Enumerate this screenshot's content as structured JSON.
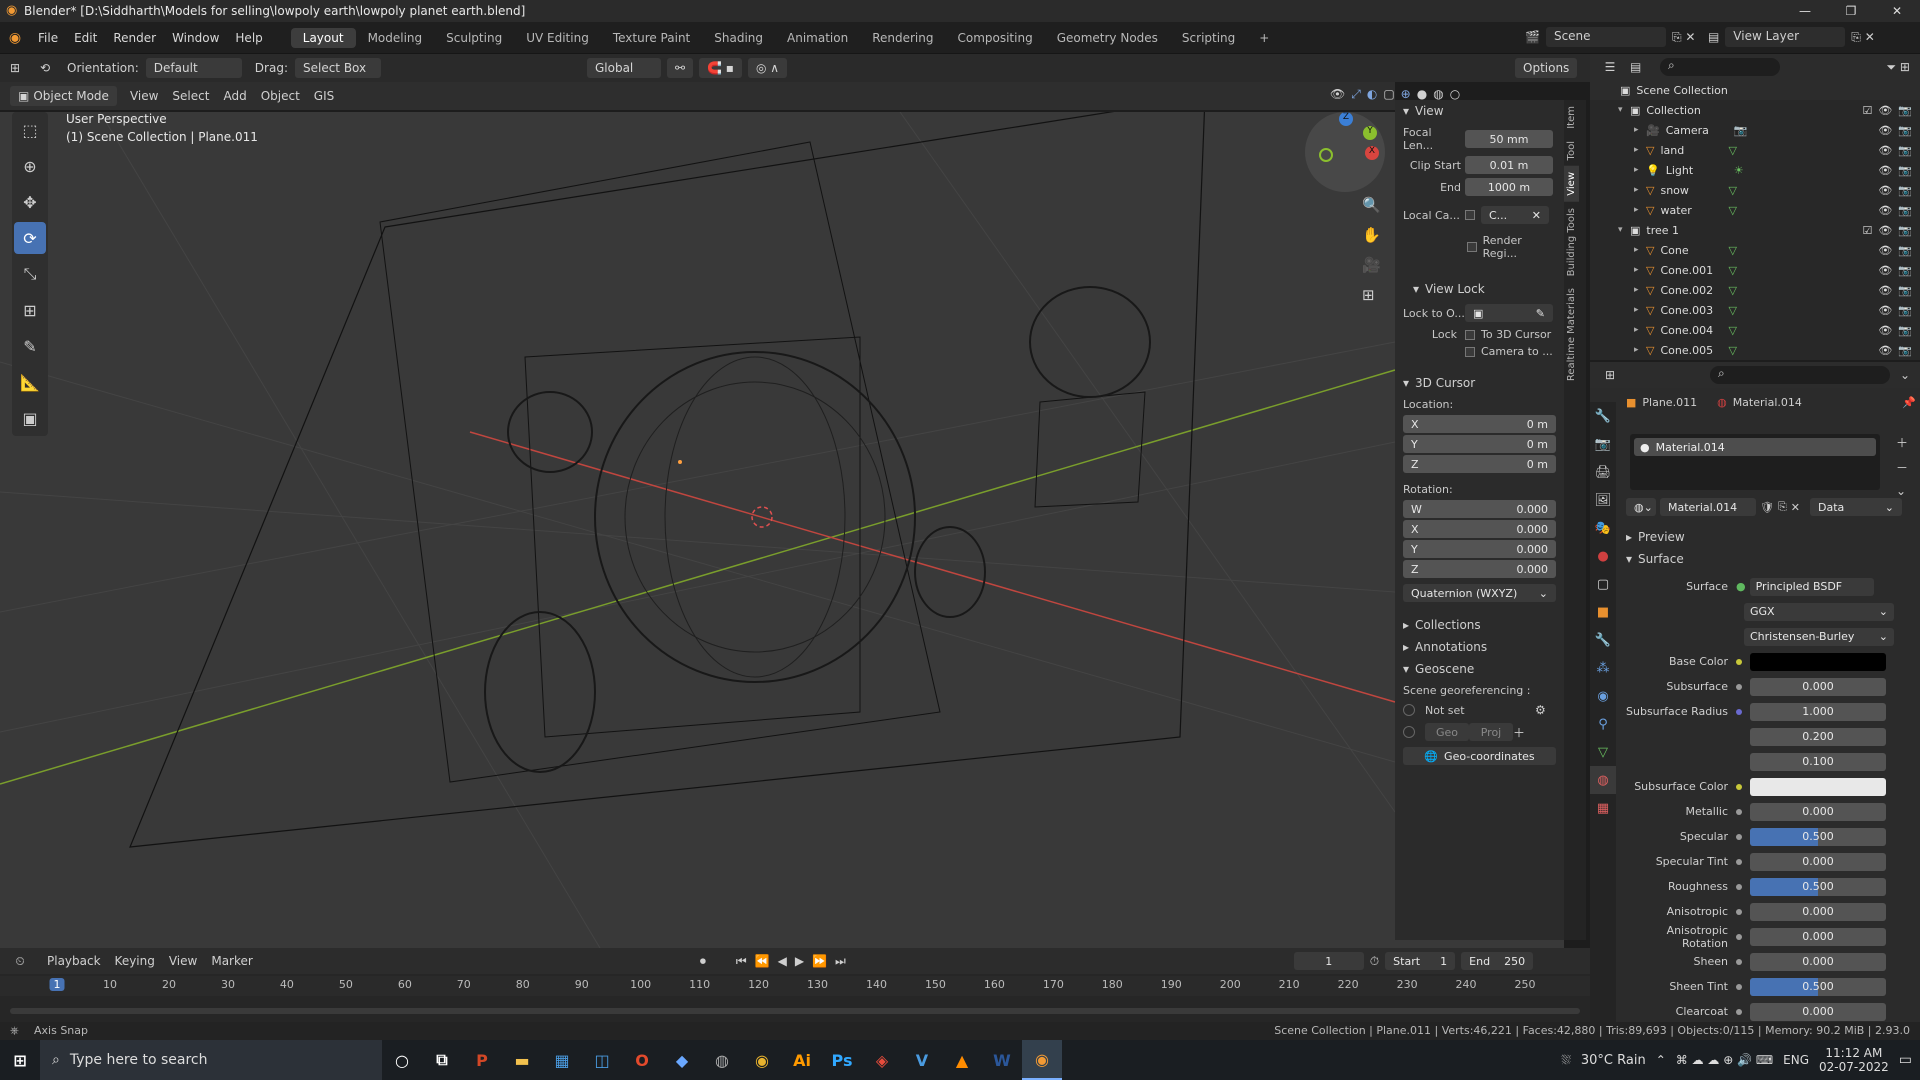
{
  "window": {
    "title": "Blender* [D:\\Siddharth\\Models for selling\\lowpoly earth\\lowpoly planet earth.blend]"
  },
  "menu": [
    "File",
    "Edit",
    "Render",
    "Window",
    "Help"
  ],
  "workspaces": [
    "Layout",
    "Modeling",
    "Sculpting",
    "UV Editing",
    "Texture Paint",
    "Shading",
    "Animation",
    "Rendering",
    "Compositing",
    "Geometry Nodes",
    "Scripting",
    "+"
  ],
  "scene": {
    "label": "Scene",
    "view_layer": "View Layer"
  },
  "toolheader": {
    "orientation_label": "Orientation:",
    "orientation_value": "Default",
    "drag_label": "Drag:",
    "drag_value": "Select Box",
    "transform": "Global",
    "options": "Options"
  },
  "viewport_header": {
    "mode": "Object Mode",
    "items": [
      "View",
      "Select",
      "Add",
      "Object",
      "GIS"
    ]
  },
  "viewport": {
    "perspective": "User Perspective",
    "context": "(1) Scene Collection | Plane.011"
  },
  "npanel": {
    "view_title": "View",
    "focal_label": "Focal Len...",
    "focal": "50 mm",
    "clip_start_label": "Clip Start",
    "clip_start": "0.01 m",
    "end_label": "End",
    "end": "1000 m",
    "local_cam_label": "Local Ca...",
    "local_cam_value": "C...",
    "render_region": "Render Regi...",
    "view_lock_title": "View Lock",
    "lock_to_label": "Lock to O...",
    "lock_label": "Lock",
    "to_cursor": "To 3D Cursor",
    "camera_to": "Camera to ...",
    "cursor_title": "3D Cursor",
    "location_label": "Location:",
    "loc_x": "0 m",
    "loc_y": "0 m",
    "loc_z": "0 m",
    "rotation_label": "Rotation:",
    "rot_w": "0.000",
    "rot_x": "0.000",
    "rot_y": "0.000",
    "rot_z": "0.000",
    "rot_mode": "Quaternion (WXYZ)",
    "collections": "Collections",
    "annotations": "Annotations",
    "geoscene": "Geoscene",
    "georef": "Scene georeferencing :",
    "not_set": "Not set",
    "geo_btn": "Geo",
    "proj_btn": "Proj",
    "geocoords": "Geo-coordinates"
  },
  "vtabs": [
    "Item",
    "Tool",
    "View",
    "Building Tools",
    "Realtime Materials"
  ],
  "outliner": {
    "root": "Scene Collection",
    "items": [
      {
        "name": "Collection",
        "level": 1,
        "kind": "collection"
      },
      {
        "name": "Camera",
        "level": 2,
        "kind": "camera"
      },
      {
        "name": "land",
        "level": 2,
        "kind": "mesh"
      },
      {
        "name": "Light",
        "level": 2,
        "kind": "light"
      },
      {
        "name": "snow",
        "level": 2,
        "kind": "mesh"
      },
      {
        "name": "water",
        "level": 2,
        "kind": "mesh"
      },
      {
        "name": "tree 1",
        "level": 1,
        "kind": "collection"
      },
      {
        "name": "Cone",
        "level": 2,
        "kind": "mesh"
      },
      {
        "name": "Cone.001",
        "level": 2,
        "kind": "mesh"
      },
      {
        "name": "Cone.002",
        "level": 2,
        "kind": "mesh"
      },
      {
        "name": "Cone.003",
        "level": 2,
        "kind": "mesh"
      },
      {
        "name": "Cone.004",
        "level": 2,
        "kind": "mesh"
      },
      {
        "name": "Cone.005",
        "level": 2,
        "kind": "mesh"
      }
    ]
  },
  "properties": {
    "object": "Plane.011",
    "material": "Material.014",
    "slot": "Material.014",
    "link": "Data",
    "preview": "Preview",
    "surface_section": "Surface",
    "surface_label": "Surface",
    "surface_value": "Principled BSDF",
    "distribution": "GGX",
    "subsurface_method": "Christensen-Burley",
    "rows": [
      {
        "label": "Base Color",
        "value": "",
        "swatch": "#000000"
      },
      {
        "label": "Subsurface",
        "value": "0.000"
      },
      {
        "label": "Subsurface Radius",
        "value": "1.000"
      },
      {
        "label": "",
        "value": "0.200"
      },
      {
        "label": "",
        "value": "0.100"
      },
      {
        "label": "Subsurface Color",
        "value": "",
        "swatch": "#e8e8e8"
      },
      {
        "label": "Metallic",
        "value": "0.000"
      },
      {
        "label": "Specular",
        "value": "0.500",
        "fill": 0.5
      },
      {
        "label": "Specular Tint",
        "value": "0.000"
      },
      {
        "label": "Roughness",
        "value": "0.500",
        "fill": 0.5
      },
      {
        "label": "Anisotropic",
        "value": "0.000"
      },
      {
        "label": "Anisotropic Rotation",
        "value": "0.000"
      },
      {
        "label": "Sheen",
        "value": "0.000"
      },
      {
        "label": "Sheen Tint",
        "value": "0.500",
        "fill": 0.5
      },
      {
        "label": "Clearcoat",
        "value": "0.000"
      }
    ]
  },
  "timeline": {
    "menus": [
      "Playback",
      "Keying",
      "View",
      "Marker"
    ],
    "current": "1",
    "start_label": "Start",
    "start": "1",
    "end_label": "End",
    "end": "250",
    "ticks": [
      "1",
      "10",
      "20",
      "30",
      "40",
      "50",
      "60",
      "70",
      "80",
      "90",
      "100",
      "110",
      "120",
      "130",
      "140",
      "150",
      "160",
      "170",
      "180",
      "190",
      "200",
      "210",
      "220",
      "230",
      "240",
      "250"
    ]
  },
  "status": {
    "left": "Axis Snap",
    "right": "Scene Collection | Plane.011 | Verts:46,221 | Faces:42,880 | Tris:89,693 | Objects:0/115 | Memory: 90.2 MiB | 2.93.0"
  },
  "taskbar": {
    "search": "Type here to search",
    "weather": "30°C  Rain",
    "lang": "ENG",
    "time": "11:12 AM",
    "date": "02-07-2022"
  },
  "colors": {
    "accent": "#4772b3",
    "x_axis": "#c0463f",
    "y_axis": "#7a9e2c"
  }
}
